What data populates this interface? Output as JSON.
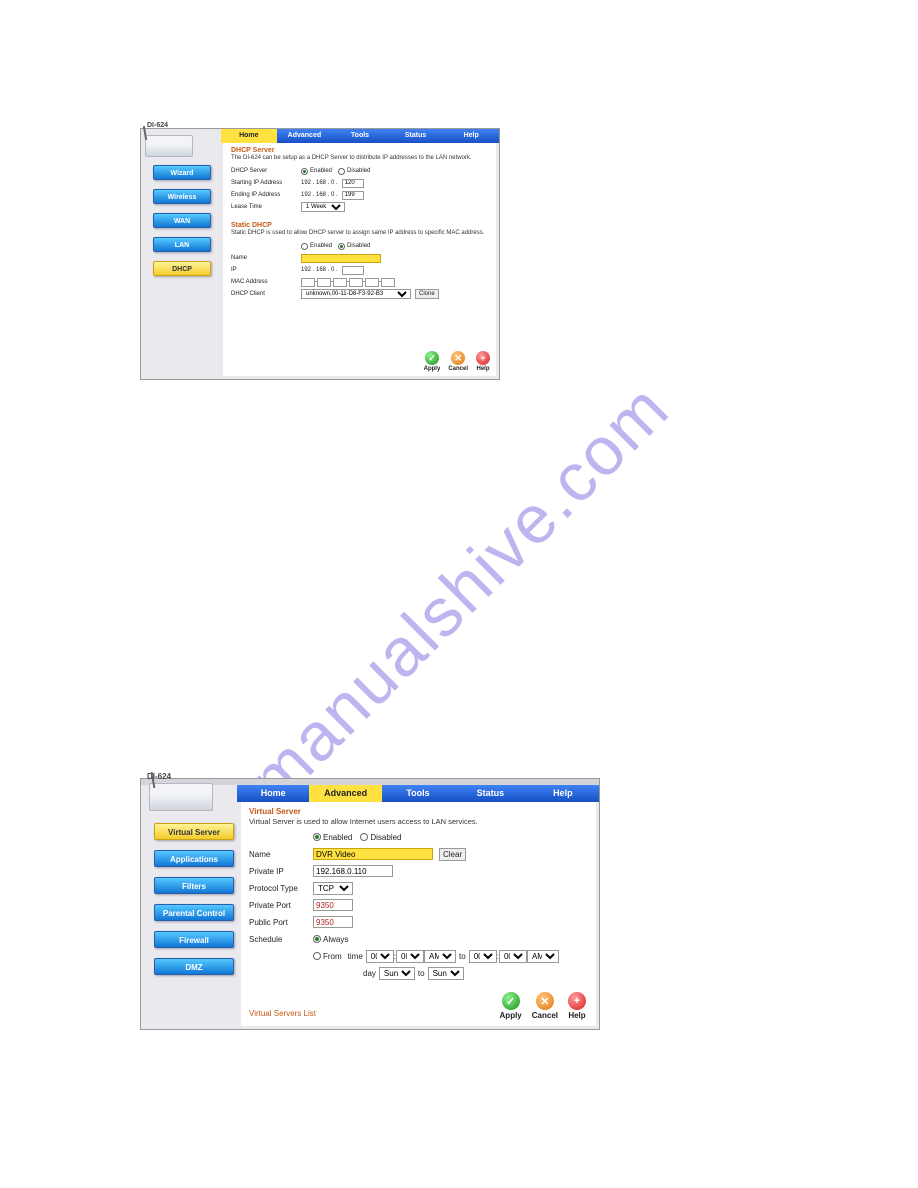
{
  "watermark": "manualshive.com",
  "panel1": {
    "model": "DI-624",
    "tabs": {
      "home": "Home",
      "advanced": "Advanced",
      "tools": "Tools",
      "status": "Status",
      "help": "Help"
    },
    "sidebar": [
      "Wizard",
      "Wireless",
      "WAN",
      "LAN",
      "DHCP"
    ],
    "section1": {
      "title": "DHCP Server",
      "desc": "The DI-624 can be setup as a DHCP Server to distribute IP addresses to the LAN network.",
      "rows": {
        "dhcp_server": "DHCP Server",
        "enabled": "Enabled",
        "disabled": "Disabled",
        "start_ip": "Starting IP Address",
        "end_ip": "Ending IP Address",
        "lease": "Lease Time",
        "ip_prefix": "192 . 168 . 0 .",
        "start_val": "120",
        "end_val": "199",
        "lease_val": "1 Week"
      }
    },
    "section2": {
      "title": "Static DHCP",
      "desc": "Static DHCP is used to allow DHCP server to assign same IP address to specific MAC address.",
      "rows": {
        "enabled": "Enabled",
        "disabled": "Disabled",
        "name": "Name",
        "ip": "IP",
        "ip_prefix": "192 . 168 . 0 .",
        "mac": "MAC Address",
        "client": "DHCP Client",
        "client_val": "unknown,00-11-D8-F3-92-B3",
        "clone": "Clone"
      }
    },
    "actions": {
      "apply": "Apply",
      "cancel": "Cancel",
      "help": "Help"
    }
  },
  "panel2": {
    "model": "DI-624",
    "tabs": {
      "home": "Home",
      "advanced": "Advanced",
      "tools": "Tools",
      "status": "Status",
      "help": "Help"
    },
    "sidebar": [
      "Virtual Server",
      "Applications",
      "Filters",
      "Parental Control",
      "Firewall",
      "DMZ"
    ],
    "section": {
      "title": "Virtual Server",
      "desc": "Virtual Server is used to allow Internet users access to LAN services.",
      "enabled": "Enabled",
      "disabled": "Disabled",
      "name": "Name",
      "name_val": "DVR Video",
      "clear": "Clear",
      "private_ip": "Private IP",
      "private_ip_val": "192.168.0.110",
      "protocol": "Protocol Type",
      "protocol_val": "TCP",
      "private_port": "Private Port",
      "private_port_val": "9350",
      "public_port": "Public Port",
      "public_port_val": "9350",
      "schedule": "Schedule",
      "always": "Always",
      "from": "From",
      "time": "time",
      "day": "day",
      "to": "to",
      "h00": "00",
      "am": "AM",
      "sun": "Sun"
    },
    "list_title": "Virtual Servers List",
    "actions": {
      "apply": "Apply",
      "cancel": "Cancel",
      "help": "Help"
    }
  }
}
